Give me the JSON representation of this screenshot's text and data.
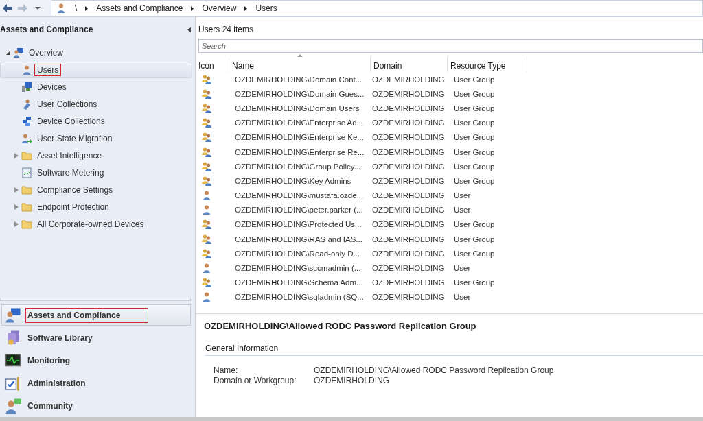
{
  "breadcrumb": {
    "items": [
      "\\",
      "Assets and Compliance",
      "Overview",
      "Users"
    ]
  },
  "navigation": {
    "title": "Assets and Compliance",
    "tree": [
      {
        "label": "Overview",
        "expanded": true,
        "selected": false,
        "highlighted": false,
        "children": [
          {
            "label": "Users",
            "selected": true,
            "highlighted": true
          },
          {
            "label": "Devices",
            "selected": false,
            "highlighted": false
          },
          {
            "label": "User Collections",
            "selected": false,
            "highlighted": false
          },
          {
            "label": "Device Collections",
            "selected": false,
            "highlighted": false
          },
          {
            "label": "User State Migration",
            "selected": false,
            "highlighted": false
          },
          {
            "label": "Asset Intelligence",
            "expanded": false,
            "selected": false,
            "highlighted": false
          },
          {
            "label": "Software Metering",
            "selected": false,
            "highlighted": false
          },
          {
            "label": "Compliance Settings",
            "expanded": false,
            "selected": false,
            "highlighted": false
          },
          {
            "label": "Endpoint Protection",
            "expanded": false,
            "selected": false,
            "highlighted": false
          },
          {
            "label": "All Corporate-owned Devices",
            "expanded": false,
            "selected": false,
            "highlighted": false
          }
        ]
      }
    ]
  },
  "workspaces": [
    {
      "label": "Assets and Compliance",
      "selected": true,
      "highlighted": true
    },
    {
      "label": "Software Library",
      "selected": false,
      "highlighted": false
    },
    {
      "label": "Monitoring",
      "selected": false,
      "highlighted": false
    },
    {
      "label": "Administration",
      "selected": false,
      "highlighted": false
    },
    {
      "label": "Community",
      "selected": false,
      "highlighted": false
    }
  ],
  "list": {
    "title": "Users 24 items",
    "search": {
      "placeholder": "Search"
    },
    "columns": [
      {
        "label": "Icon",
        "sorted": false
      },
      {
        "label": "Name",
        "sorted": true
      },
      {
        "label": "Domain",
        "sorted": false
      },
      {
        "label": "Resource Type",
        "sorted": false
      }
    ],
    "rows": [
      {
        "kind": "group",
        "name": "OZDEMIRHOLDING\\Domain Cont...",
        "domain": "OZDEMIRHOLDING",
        "type": "User Group"
      },
      {
        "kind": "group",
        "name": "OZDEMIRHOLDING\\Domain Gues...",
        "domain": "OZDEMIRHOLDING",
        "type": "User Group"
      },
      {
        "kind": "group",
        "name": "OZDEMIRHOLDING\\Domain Users",
        "domain": "OZDEMIRHOLDING",
        "type": "User Group"
      },
      {
        "kind": "group",
        "name": "OZDEMIRHOLDING\\Enterprise Ad...",
        "domain": "OZDEMIRHOLDING",
        "type": "User Group"
      },
      {
        "kind": "group",
        "name": "OZDEMIRHOLDING\\Enterprise Ke...",
        "domain": "OZDEMIRHOLDING",
        "type": "User Group"
      },
      {
        "kind": "group",
        "name": "OZDEMIRHOLDING\\Enterprise Re...",
        "domain": "OZDEMIRHOLDING",
        "type": "User Group"
      },
      {
        "kind": "group",
        "name": "OZDEMIRHOLDING\\Group Policy...",
        "domain": "OZDEMIRHOLDING",
        "type": "User Group"
      },
      {
        "kind": "group",
        "name": "OZDEMIRHOLDING\\Key Admins",
        "domain": "OZDEMIRHOLDING",
        "type": "User Group"
      },
      {
        "kind": "user",
        "name": "OZDEMIRHOLDING\\mustafa.ozde...",
        "domain": "OZDEMIRHOLDING",
        "type": "User"
      },
      {
        "kind": "user",
        "name": "OZDEMIRHOLDING\\peter.parker (...",
        "domain": "OZDEMIRHOLDING",
        "type": "User"
      },
      {
        "kind": "group",
        "name": "OZDEMIRHOLDING\\Protected Us...",
        "domain": "OZDEMIRHOLDING",
        "type": "User Group"
      },
      {
        "kind": "group",
        "name": "OZDEMIRHOLDING\\RAS and IAS...",
        "domain": "OZDEMIRHOLDING",
        "type": "User Group"
      },
      {
        "kind": "group",
        "name": "OZDEMIRHOLDING\\Read-only D...",
        "domain": "OZDEMIRHOLDING",
        "type": "User Group"
      },
      {
        "kind": "user",
        "name": "OZDEMIRHOLDING\\sccmadmin (...",
        "domain": "OZDEMIRHOLDING",
        "type": "User"
      },
      {
        "kind": "group",
        "name": "OZDEMIRHOLDING\\Schema Adm...",
        "domain": "OZDEMIRHOLDING",
        "type": "User Group"
      },
      {
        "kind": "user",
        "name": "OZDEMIRHOLDING\\sqladmin (SQ...",
        "domain": "OZDEMIRHOLDING",
        "type": "User"
      }
    ]
  },
  "details": {
    "title": "OZDEMIRHOLDING\\Allowed RODC Password Replication Group",
    "section": "General Information",
    "fields": [
      {
        "label": "Name:",
        "value": "OZDEMIRHOLDING\\Allowed RODC Password Replication Group"
      },
      {
        "label": "Domain or Workgroup:",
        "value": "OZDEMIRHOLDING"
      }
    ]
  }
}
